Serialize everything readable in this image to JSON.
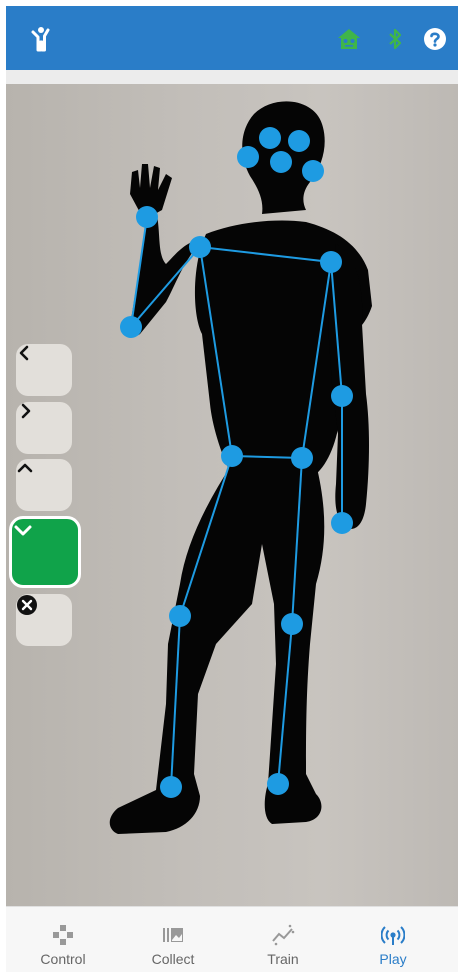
{
  "nav": {
    "items": [
      {
        "label": "Control",
        "icon": "gamepad-icon"
      },
      {
        "label": "Collect",
        "icon": "gallery-icon"
      },
      {
        "label": "Train",
        "icon": "chart-icon"
      },
      {
        "label": "Play",
        "icon": "broadcast-icon"
      }
    ],
    "active": "Play"
  },
  "header": {
    "icons": [
      "person-pose-icon",
      "robot-icon",
      "bluetooth-icon",
      "help-icon"
    ]
  },
  "controls": [
    "chevron-left-icon",
    "chevron-right-icon",
    "chevron-up-icon",
    "chevron-down-icon",
    "close-icon"
  ],
  "colors": {
    "header": "#2a7dc8",
    "accent_green": "#10a34a",
    "keypoint": "#1e9be2",
    "active_tab": "#2a7dc8"
  }
}
